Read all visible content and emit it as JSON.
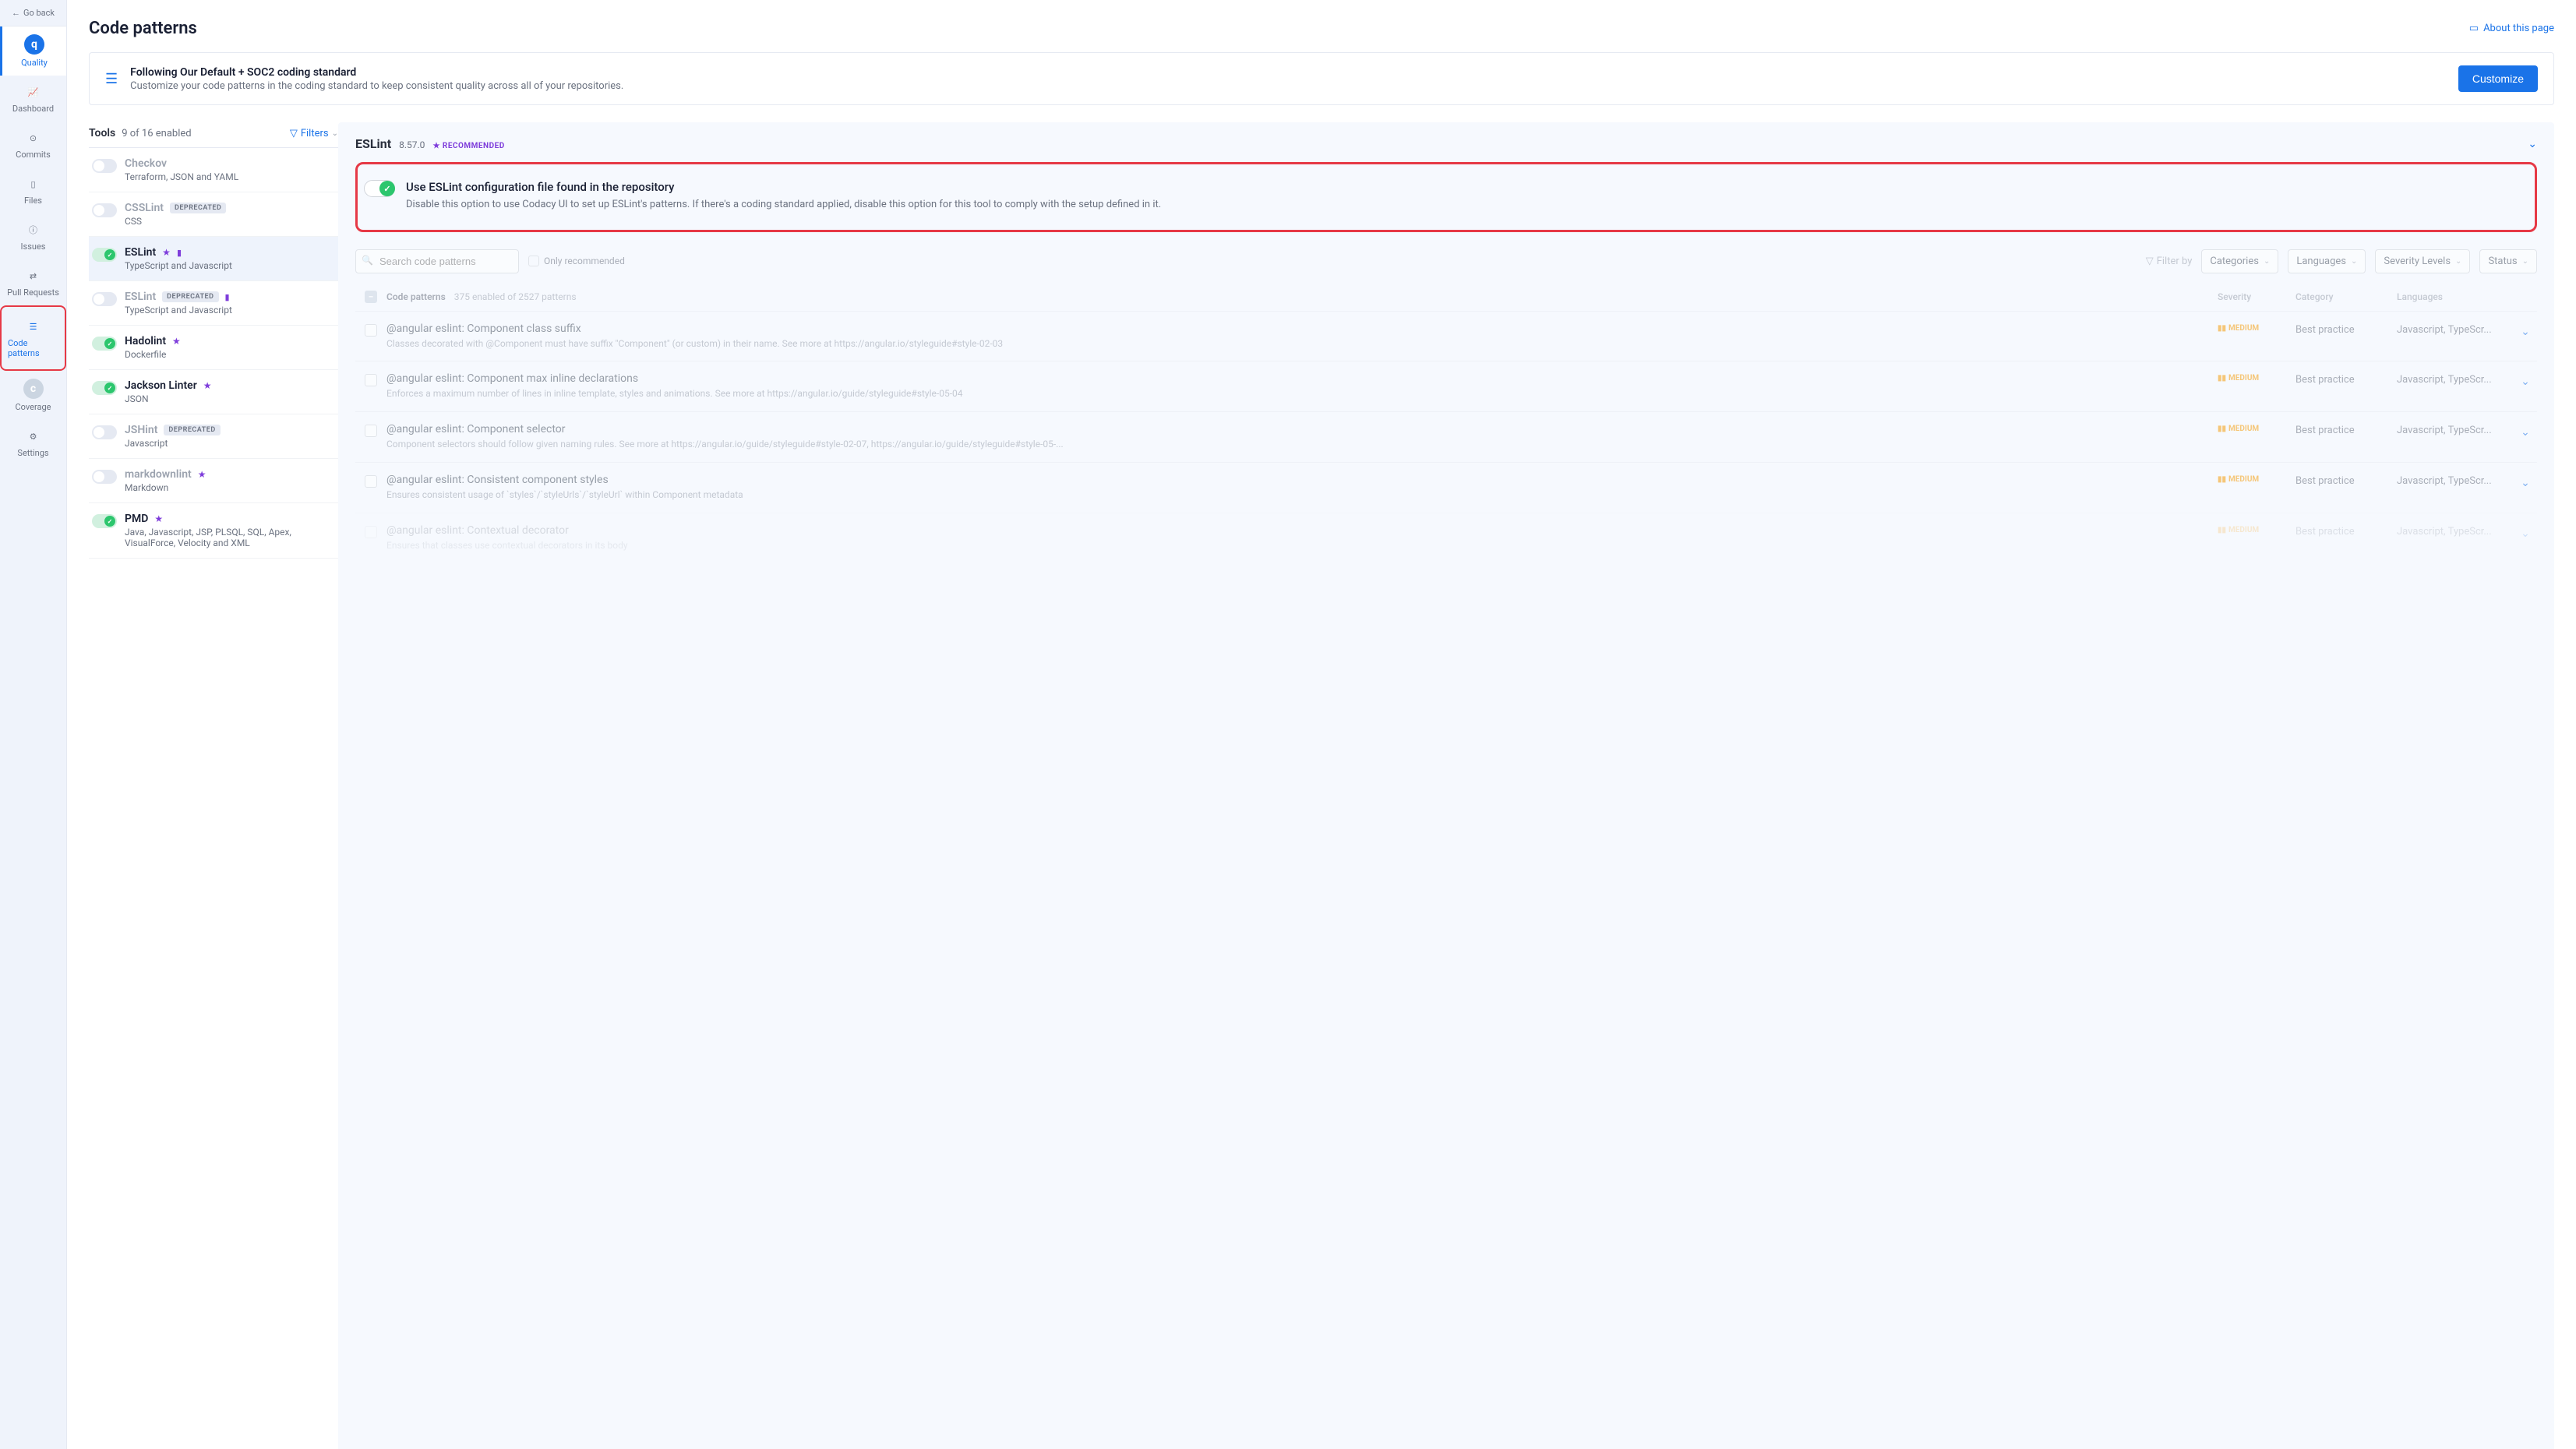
{
  "sidebar": {
    "goback": "Go back",
    "items": [
      {
        "label": "Quality",
        "icon": "q-logo"
      },
      {
        "label": "Dashboard",
        "icon": "chart-icon"
      },
      {
        "label": "Commits",
        "icon": "commit-icon"
      },
      {
        "label": "Files",
        "icon": "file-icon"
      },
      {
        "label": "Issues",
        "icon": "alert-icon"
      },
      {
        "label": "Pull Requests",
        "icon": "pr-icon"
      },
      {
        "label": "Code patterns",
        "icon": "list-icon"
      },
      {
        "label": "Coverage",
        "icon": "c-logo"
      },
      {
        "label": "Settings",
        "icon": "gear-icon"
      }
    ]
  },
  "page": {
    "title": "Code patterns",
    "about": "About this page"
  },
  "banner": {
    "title": "Following Our Default + SOC2 coding standard",
    "sub": "Customize your code patterns in the coding standard to keep consistent quality across all of your repositories.",
    "button": "Customize"
  },
  "tools_header": {
    "label": "Tools",
    "count": "9 of 16 enabled",
    "filters": "Filters"
  },
  "tools": [
    {
      "name": "Checkov",
      "langs": "Terraform, JSON and YAML",
      "on": false,
      "star": false,
      "deprecated": false,
      "file": false
    },
    {
      "name": "CSSLint",
      "langs": "CSS",
      "on": false,
      "star": false,
      "deprecated": true,
      "file": false
    },
    {
      "name": "ESLint",
      "langs": "TypeScript and Javascript",
      "on": true,
      "star": true,
      "deprecated": false,
      "file": true,
      "active": true
    },
    {
      "name": "ESLint",
      "langs": "TypeScript and Javascript",
      "on": false,
      "star": false,
      "deprecated": true,
      "file": true
    },
    {
      "name": "Hadolint",
      "langs": "Dockerfile",
      "on": true,
      "star": true,
      "deprecated": false,
      "file": false
    },
    {
      "name": "Jackson Linter",
      "langs": "JSON",
      "on": true,
      "star": true,
      "deprecated": false,
      "file": false
    },
    {
      "name": "JSHint",
      "langs": "Javascript",
      "on": false,
      "star": false,
      "deprecated": true,
      "file": false
    },
    {
      "name": "markdownlint",
      "langs": "Markdown",
      "on": false,
      "star": true,
      "deprecated": false,
      "file": false
    },
    {
      "name": "PMD",
      "langs": "Java, Javascript, JSP, PLSQL, SQL, Apex, VisualForce, Velocity and XML",
      "on": true,
      "star": true,
      "deprecated": false,
      "file": false
    }
  ],
  "deprecated_badge": "DEPRECATED",
  "detail": {
    "title": "ESLint",
    "version": "8.57.0",
    "recommended": "RECOMMENDED",
    "config_title": "Use ESLint configuration file found in the repository",
    "config_desc": "Disable this option to use Codacy UI to set up ESLint's patterns. If there's a coding standard applied, disable this option for this tool to comply with the setup defined in it."
  },
  "filters": {
    "search_placeholder": "Search code patterns",
    "only_rec": "Only recommended",
    "filter_by": "Filter by",
    "dropdowns": [
      "Categories",
      "Languages",
      "Severity Levels",
      "Status"
    ]
  },
  "table": {
    "head_name": "Code patterns",
    "head_count": "375 enabled of 2527 patterns",
    "head_sev": "Severity",
    "head_cat": "Category",
    "head_lang": "Languages"
  },
  "patterns": [
    {
      "title": "@angular eslint: Component class suffix",
      "desc": "Classes decorated with @Component must have suffix \"Component\" (or custom) in their name. See more at https://angular.io/styleguide#style-02-03",
      "sev": "MEDIUM",
      "cat": "Best practice",
      "lang": "Javascript, TypeScr..."
    },
    {
      "title": "@angular eslint: Component max inline declarations",
      "desc": "Enforces a maximum number of lines in inline template, styles and animations. See more at https://angular.io/guide/styleguide#style-05-04",
      "sev": "MEDIUM",
      "cat": "Best practice",
      "lang": "Javascript, TypeScr..."
    },
    {
      "title": "@angular eslint: Component selector",
      "desc": "Component selectors should follow given naming rules. See more at https://angular.io/guide/styleguide#style-02-07, https://angular.io/guide/styleguide#style-05-...",
      "sev": "MEDIUM",
      "cat": "Best practice",
      "lang": "Javascript, TypeScr..."
    },
    {
      "title": "@angular eslint: Consistent component styles",
      "desc": "Ensures consistent usage of `styles`/`styleUrls`/`styleUrl` within Component metadata",
      "sev": "MEDIUM",
      "cat": "Best practice",
      "lang": "Javascript, TypeScr..."
    },
    {
      "title": "@angular eslint: Contextual decorator",
      "desc": "Ensures that classes use contextual decorators in its body",
      "sev": "MEDIUM",
      "cat": "Best practice",
      "lang": "Javascript, TypeScr..."
    }
  ]
}
